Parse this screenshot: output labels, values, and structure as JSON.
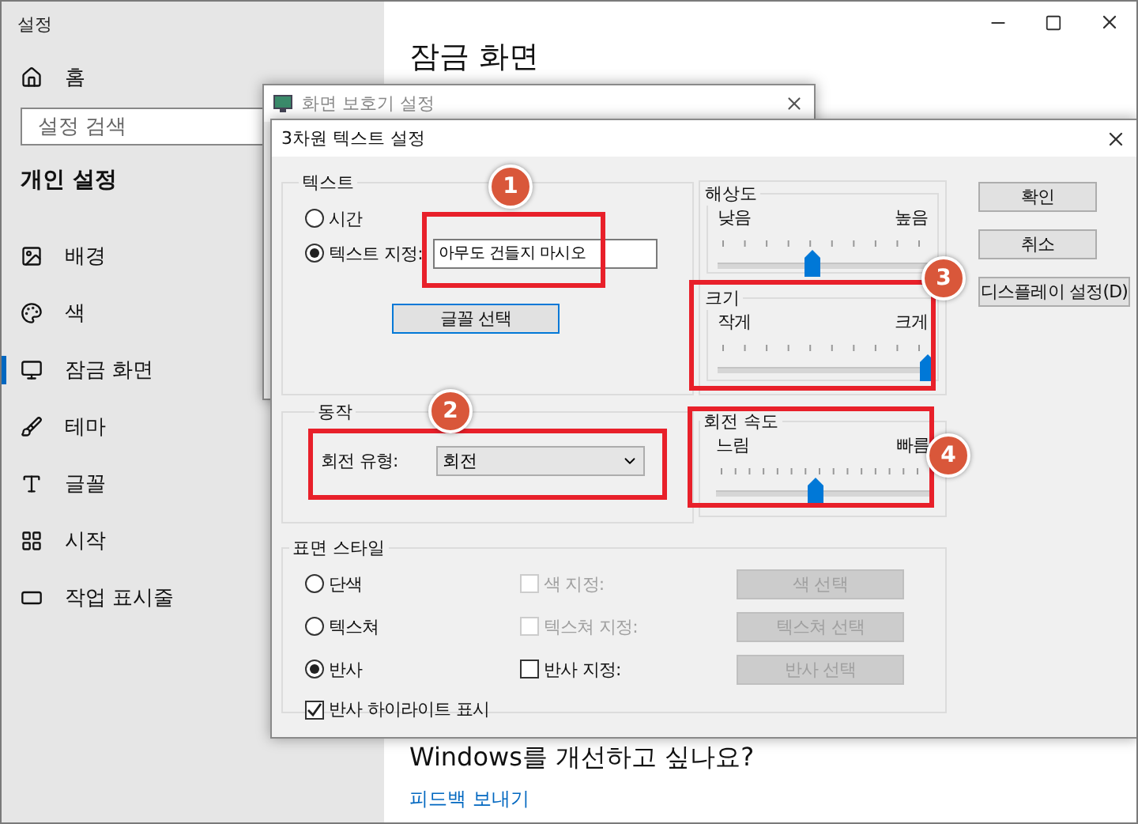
{
  "settings_window": {
    "title": "설정"
  },
  "sidebar": {
    "home": "홈",
    "search": {
      "placeholder": "설정 검색"
    },
    "section_title": "개인 설정",
    "items": [
      {
        "label": "배경",
        "selected": false
      },
      {
        "label": "색",
        "selected": false
      },
      {
        "label": "잠금 화면",
        "selected": true
      },
      {
        "label": "테마",
        "selected": false
      },
      {
        "label": "글꼴",
        "selected": false
      },
      {
        "label": "시작",
        "selected": false
      },
      {
        "label": "작업 표시줄",
        "selected": false
      }
    ]
  },
  "page": {
    "heading": "잠금 화면",
    "feedback_title": "Windows를 개선하고 싶나요?",
    "feedback_link": "피드백 보내기"
  },
  "screensaver_dialog": {
    "title": "화면 보호기 설정"
  },
  "text3d_dialog": {
    "title": "3차원 텍스트 설정",
    "text_group": {
      "title": "텍스트",
      "options": [
        {
          "label": "시간",
          "selected": false
        },
        {
          "label": "텍스트 지정:",
          "selected": true
        }
      ],
      "custom_text": "아무도 건들지 마시오",
      "font_button": "글꼴 선택"
    },
    "resolution": {
      "title": "해상도",
      "min_label": "낮음",
      "max_label": "높음",
      "level": 0.45
    },
    "size": {
      "title": "크기",
      "min_label": "작게",
      "max_label": "크게",
      "level": 1
    },
    "motion": {
      "title": "동작",
      "rotation_label": "회전 유형:",
      "rotation_value": "회전"
    },
    "rotation_speed": {
      "title": "회전 속도",
      "min_label": "느림",
      "max_label": "빠름",
      "level": 0.47
    },
    "surface": {
      "title": "표면 스타일",
      "rows": [
        {
          "option": "단색",
          "selected": false,
          "check_label": "색 지정:",
          "checked": false,
          "check_disabled": true,
          "button": "색 선택",
          "button_disabled": true
        },
        {
          "option": "텍스쳐",
          "selected": false,
          "check_label": "텍스쳐 지정:",
          "checked": false,
          "check_disabled": true,
          "button": "텍스쳐 선택",
          "button_disabled": true
        },
        {
          "option": "반사",
          "selected": true,
          "check_label": "반사 지정:",
          "checked": false,
          "check_disabled": false,
          "button": "반사 선택",
          "button_disabled": true
        }
      ],
      "highlight": {
        "label": "반사 하이라이트 표시",
        "checked": true
      }
    },
    "buttons": [
      "확인",
      "취소",
      "디스플레이 설정(D)"
    ]
  },
  "annotations": [
    {
      "number": "1"
    },
    {
      "number": "2"
    },
    {
      "number": "3"
    },
    {
      "number": "4"
    }
  ]
}
